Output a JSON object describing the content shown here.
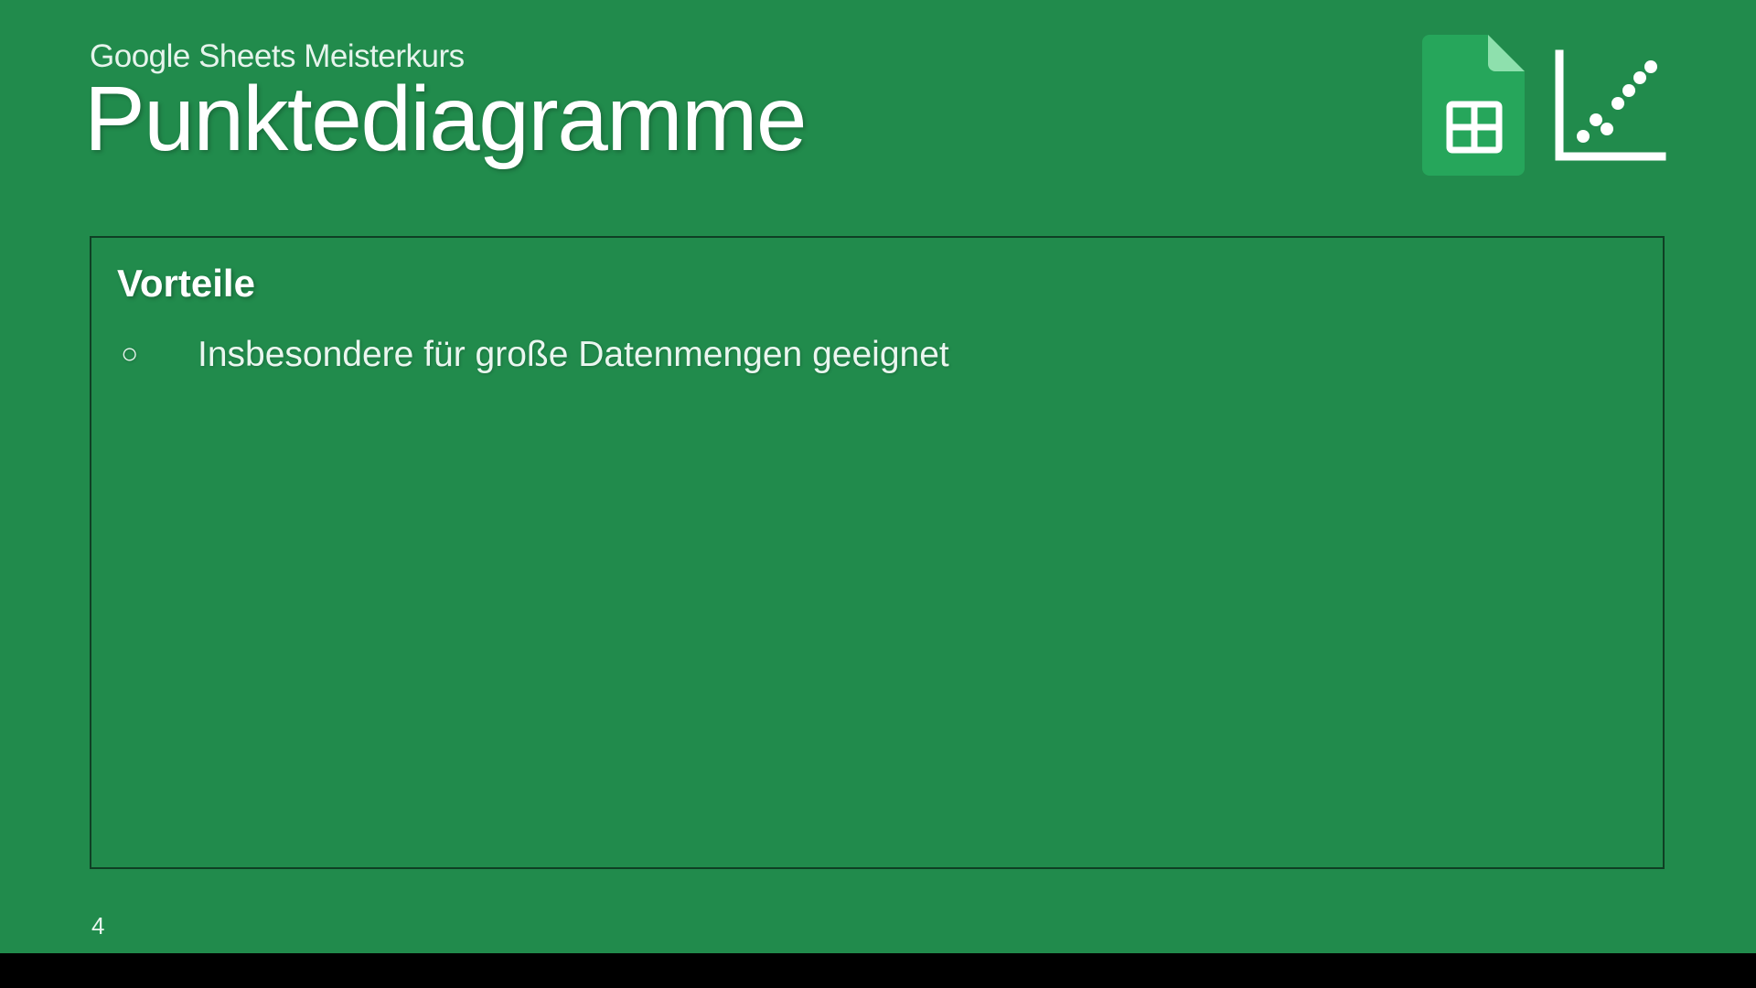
{
  "slide": {
    "subtitle": "Google Sheets Meisterkurs",
    "title": "Punktediagramme",
    "section_heading": "Vorteile",
    "bullets": [
      "Insbesondere für große Datenmengen geeignet"
    ],
    "page_number": "4"
  },
  "colors": {
    "background": "#218b4c",
    "border": "#0f3f24",
    "sheets_green": "#26a65b",
    "sheets_fold": "#7fd8a3"
  }
}
